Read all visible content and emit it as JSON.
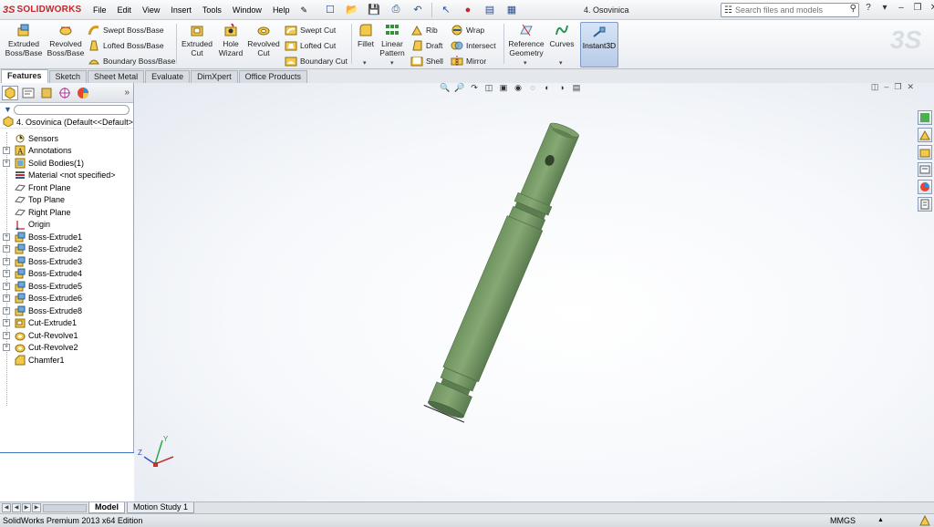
{
  "app": {
    "logo_ds": "3S",
    "logo_name": "SOLIDWORKS",
    "document_title": "4. Osovinica",
    "menu": [
      "File",
      "Edit",
      "View",
      "Insert",
      "Tools",
      "Window",
      "Help"
    ],
    "search_placeholder": "Search files and models",
    "help_label": "?"
  },
  "command_manager": {
    "extruded_boss": "Extruded\nBoss/Base",
    "revolved_boss": "Revolved\nBoss/Base",
    "swept_boss": "Swept Boss/Base",
    "lofted_boss": "Lofted Boss/Base",
    "boundary_boss": "Boundary Boss/Base",
    "extruded_cut": "Extruded\nCut",
    "hole_wizard": "Hole\nWizard",
    "revolved_cut": "Revolved\nCut",
    "swept_cut": "Swept Cut",
    "lofted_cut": "Lofted Cut",
    "boundary_cut": "Boundary Cut",
    "fillet": "Fillet",
    "linear_pattern": "Linear\nPattern",
    "rib": "Rib",
    "draft": "Draft",
    "shell": "Shell",
    "wrap": "Wrap",
    "intersect": "Intersect",
    "mirror": "Mirror",
    "reference_geometry": "Reference\nGeometry",
    "curves": "Curves",
    "instant3d": "Instant3D"
  },
  "tabs": [
    {
      "label": "Features",
      "active": true
    },
    {
      "label": "Sketch",
      "active": false
    },
    {
      "label": "Sheet Metal",
      "active": false
    },
    {
      "label": "Evaluate",
      "active": false
    },
    {
      "label": "DimXpert",
      "active": false
    },
    {
      "label": "Office Products",
      "active": false
    }
  ],
  "feature_tree": {
    "root": "4. Osovinica  (Default<<Default>",
    "items": [
      {
        "label": "Sensors",
        "icon": "sensor-icon",
        "expandable": false
      },
      {
        "label": "Annotations",
        "icon": "annotation-icon",
        "expandable": true
      },
      {
        "label": "Solid Bodies(1)",
        "icon": "solid-bodies-icon",
        "expandable": true
      },
      {
        "label": "Material <not specified>",
        "icon": "material-icon",
        "expandable": false
      },
      {
        "label": "Front Plane",
        "icon": "plane-icon",
        "expandable": false
      },
      {
        "label": "Top Plane",
        "icon": "plane-icon",
        "expandable": false
      },
      {
        "label": "Right Plane",
        "icon": "plane-icon",
        "expandable": false
      },
      {
        "label": "Origin",
        "icon": "origin-icon",
        "expandable": false
      },
      {
        "label": "Boss-Extrude1",
        "icon": "extrude-icon",
        "expandable": true
      },
      {
        "label": "Boss-Extrude2",
        "icon": "extrude-icon",
        "expandable": true
      },
      {
        "label": "Boss-Extrude3",
        "icon": "extrude-icon",
        "expandable": true
      },
      {
        "label": "Boss-Extrude4",
        "icon": "extrude-icon",
        "expandable": true
      },
      {
        "label": "Boss-Extrude5",
        "icon": "extrude-icon",
        "expandable": true
      },
      {
        "label": "Boss-Extrude6",
        "icon": "extrude-icon",
        "expandable": true
      },
      {
        "label": "Boss-Extrude8",
        "icon": "extrude-icon",
        "expandable": true
      },
      {
        "label": "Cut-Extrude1",
        "icon": "cut-extrude-icon",
        "expandable": true
      },
      {
        "label": "Cut-Revolve1",
        "icon": "cut-revolve-icon",
        "expandable": true
      },
      {
        "label": "Cut-Revolve2",
        "icon": "cut-revolve-icon",
        "expandable": true
      },
      {
        "label": "Chamfer1",
        "icon": "chamfer-icon",
        "expandable": false
      }
    ]
  },
  "bottom_tabs": [
    {
      "label": "Model",
      "active": true
    },
    {
      "label": "Motion Study 1",
      "active": false
    }
  ],
  "status": {
    "edition": "SolidWorks Premium 2013 x64 Edition",
    "units": "MMGS"
  },
  "colors": {
    "part_green": "#7ea06a",
    "part_shadow": "#56754a",
    "accent_red": "#c0282d"
  }
}
